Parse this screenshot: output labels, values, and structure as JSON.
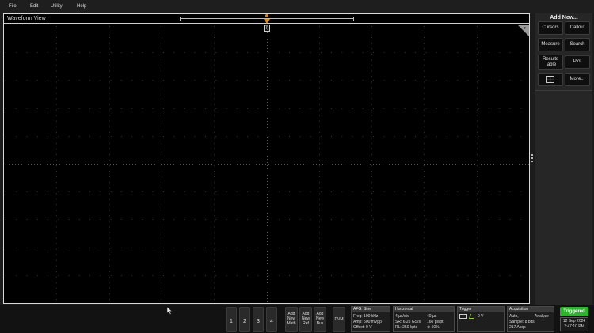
{
  "menubar": {
    "items": [
      "File",
      "Edit",
      "Utility",
      "Help"
    ]
  },
  "waveform_view": {
    "title": "Waveform View",
    "trigger_marker": "T"
  },
  "right_panel": {
    "title": "Add New...",
    "buttons": {
      "cursors": "Cursors",
      "callout": "Callout",
      "measure": "Measure",
      "search": "Search",
      "results_table_1": "Results",
      "results_table_2": "Table",
      "plot": "Plot",
      "more": "More..."
    }
  },
  "bottom_bar": {
    "channels": [
      "1",
      "2",
      "3",
      "4"
    ],
    "add_math": [
      "Add",
      "New",
      "Math"
    ],
    "add_ref": [
      "Add",
      "New",
      "Ref"
    ],
    "add_bus": [
      "Add",
      "New",
      "Bus"
    ],
    "dvm": "DVM",
    "afg": {
      "title": "AFG: Sine",
      "freq": "Freq: 100 kHz",
      "amp": "Amp: 500 mVpp",
      "offset": "Offset: 0 V"
    },
    "horizontal": {
      "title": "Horizontal",
      "col1": [
        "4 µs/div",
        "SR: 6.25 GS/s",
        "RL: 250 kpts"
      ],
      "col2": [
        "40 µs",
        "160 ps/pt",
        "⊕ 50%"
      ]
    },
    "trigger": {
      "title": "Trigger",
      "level": "0 V"
    },
    "acquisition": {
      "title": "Acquisition",
      "line1_left": "Auto,",
      "line1_right": "Analyze",
      "line2": "Sample: 8 bits",
      "line3": "217 Acqs"
    },
    "status": "Triggered",
    "date": "12 Sep 2024",
    "time": "2:47:10 PM"
  },
  "colors": {
    "triggered": "#2fb32f",
    "trigger_marker": "#d08a2a",
    "background": "#000000"
  }
}
